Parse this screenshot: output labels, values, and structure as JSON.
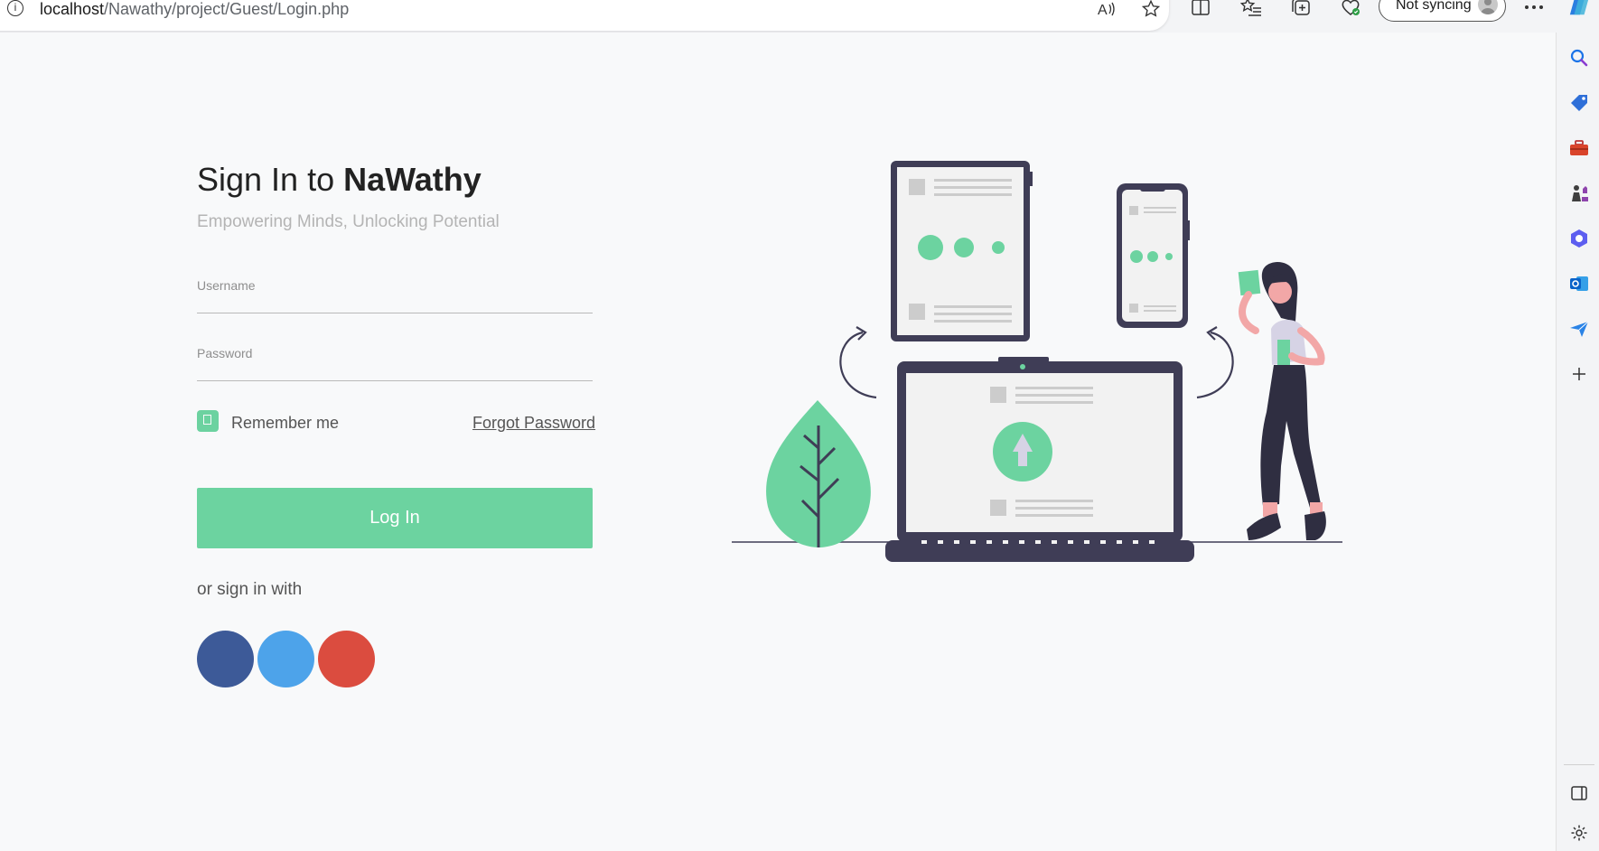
{
  "browser": {
    "url_host": "localhost",
    "url_path": "/Nawathy/project/Guest/Login.php",
    "sync_label": "Not syncing"
  },
  "login": {
    "title_prefix": "Sign In to ",
    "title_brand": "NaWathy",
    "subtitle": "Empowering Minds, Unlocking Potential",
    "username_placeholder": "Username",
    "password_placeholder": "Password",
    "remember_label": "Remember me",
    "forgot_label": "Forgot Password",
    "login_button": "Log In",
    "or_label": "or sign in with"
  },
  "social": [
    {
      "name": "facebook",
      "color": "#3d5a98"
    },
    {
      "name": "twitter",
      "color": "#4da3ea"
    },
    {
      "name": "google",
      "color": "#db4c3f"
    }
  ],
  "colors": {
    "accent": "#6cd3a0",
    "dark": "#3f3d56",
    "light_panel": "#f2f2f2"
  }
}
